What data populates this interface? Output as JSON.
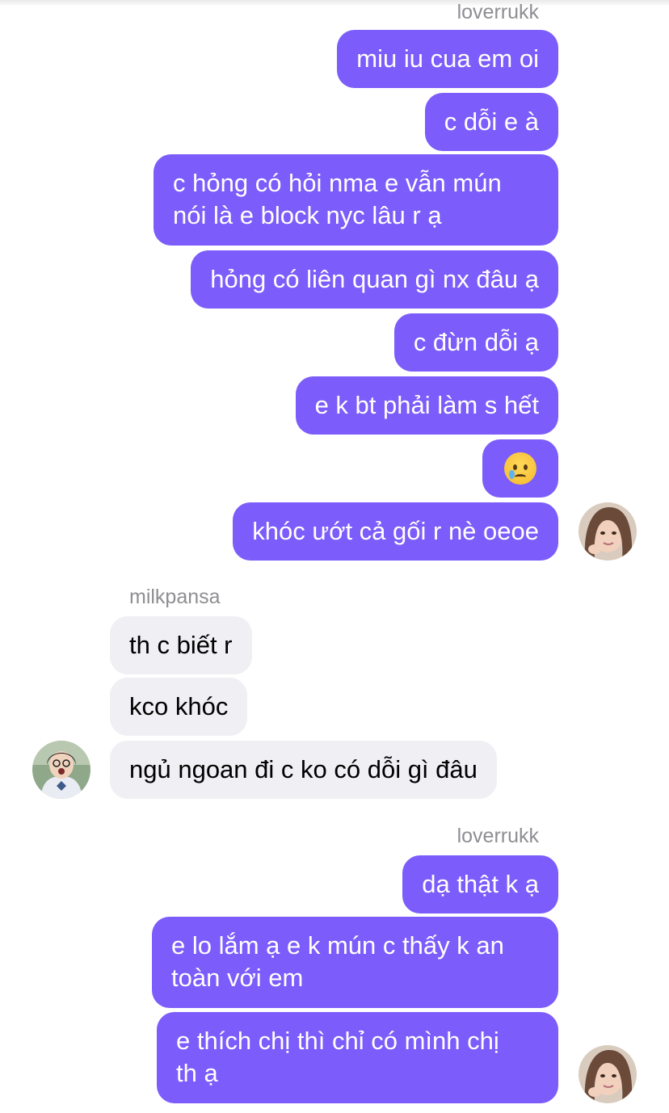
{
  "chat": {
    "groups": [
      {
        "sender": "loverrukk",
        "side": "outgoing",
        "messages": [
          "miu iu cua em oi",
          "c dỗi e à",
          "c hỏng có hỏi nma e vẫn mún\nnói là e block nyc lâu r ạ",
          "hỏng có liên quan gì nx đâu ạ",
          "c đừn dỗi ạ",
          "e k bt phải làm s hết",
          "😢",
          "khóc ướt cả gối r nè oeoe"
        ]
      },
      {
        "sender": "milkpansa",
        "side": "incoming",
        "messages": [
          "th c biết r",
          "kco khóc",
          "ngủ ngoan đi c ko có dỗi gì đâu"
        ]
      },
      {
        "sender": "loverrukk",
        "side": "outgoing",
        "messages": [
          "dạ thật k ạ",
          "e lo lắm ạ e k mún c thấy k an\ntoàn với em",
          "e thích chị thì chỉ có mình chị\nth ạ"
        ]
      }
    ]
  },
  "colors": {
    "outgoing_bubble": "#7c5cfa",
    "incoming_bubble": "#efeff4",
    "sender_name": "#8e8e93"
  },
  "icons": {
    "crying_emoji": "crying-face-emoji",
    "avatar_outgoing": "avatar-loverrukk",
    "avatar_incoming": "avatar-milkpansa"
  }
}
